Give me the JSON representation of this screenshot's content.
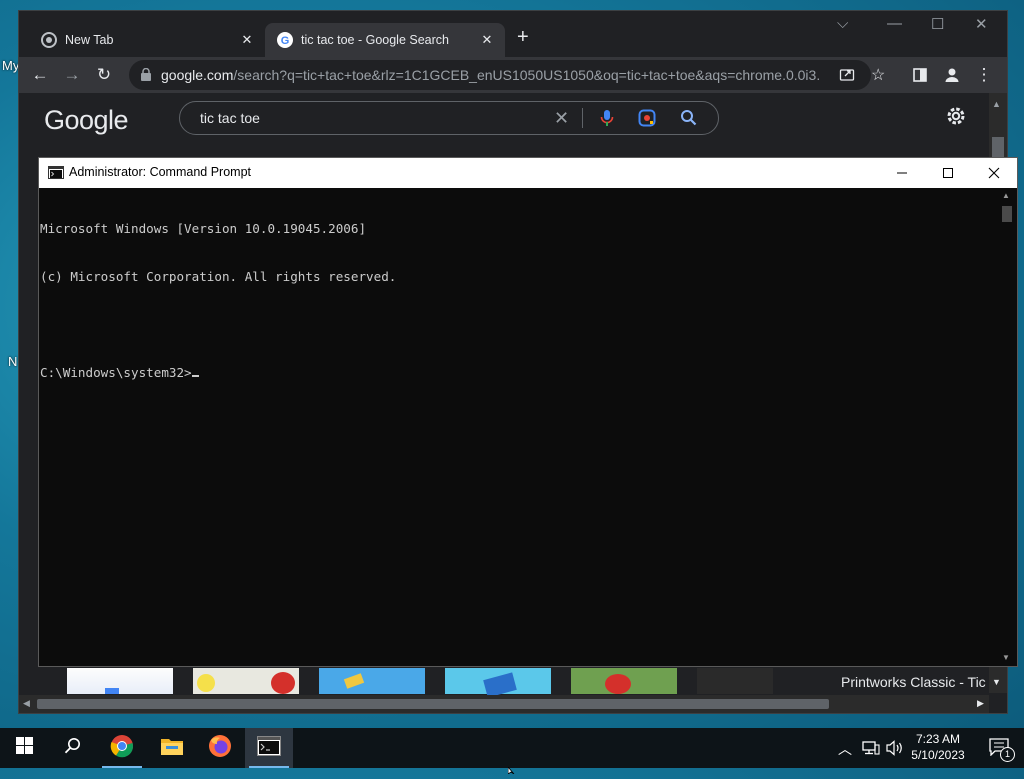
{
  "desktop": {
    "edge_labels": [
      "My",
      "N"
    ]
  },
  "chrome": {
    "tabs": [
      {
        "title": "New Tab",
        "active": false
      },
      {
        "title": "tic tac toe - Google Search",
        "active": true
      }
    ],
    "toolbar": {
      "url_host": "google.com",
      "url_rest": "/search?q=tic+tac+toe&rlz=1C1GCEB_enUS1050US1050&oq=tic+tac+toe&aqs=chrome.0.0i3..."
    },
    "page": {
      "logo": "Google",
      "search_query": "tic tac toe",
      "result_caption": "Printworks Classic - Tic"
    }
  },
  "cmd": {
    "title": "Administrator: Command Prompt",
    "lines": [
      "Microsoft Windows [Version 10.0.19045.2006]",
      "(c) Microsoft Corporation. All rights reserved.",
      "",
      "C:\\Windows\\system32>"
    ]
  },
  "taskbar": {
    "time": "7:23 AM",
    "date": "5/10/2023",
    "notification_count": "1"
  },
  "colors": {
    "accent": "#76b9ed",
    "chrome_bg": "#202124",
    "console_bg": "#0c0c0c"
  }
}
